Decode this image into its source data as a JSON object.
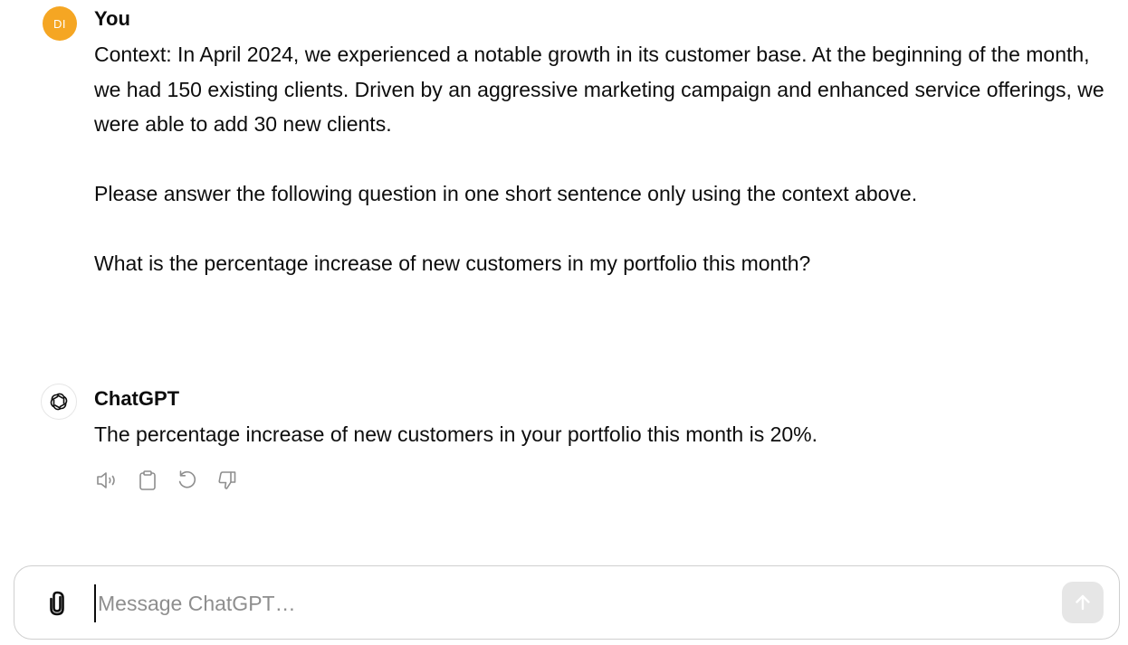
{
  "conversation": {
    "user_message": {
      "avatar_initials": "DI",
      "avatar_color": "#f5a623",
      "author": "You",
      "paragraphs": [
        "Context: In April 2024, we experienced a notable growth in its customer base. At the beginning of the month, we had 150 existing clients. Driven by an aggressive marketing campaign and enhanced service offerings, we were able to add 30 new clients.",
        "Please answer the following question in one short sentence only using the context above.",
        "What is the percentage increase of new customers in my portfolio this month?"
      ]
    },
    "assistant_message": {
      "author": "ChatGPT",
      "avatar_icon": "openai-logo-icon",
      "text": "The percentage increase of new customers in your portfolio this month is 20%.",
      "actions": [
        "read-aloud-icon",
        "copy-icon",
        "regenerate-icon",
        "thumbs-down-icon"
      ]
    }
  },
  "composer": {
    "placeholder": "Message ChatGPT…",
    "value": "",
    "attach_icon": "paperclip-icon",
    "send_icon": "arrow-up-icon"
  }
}
